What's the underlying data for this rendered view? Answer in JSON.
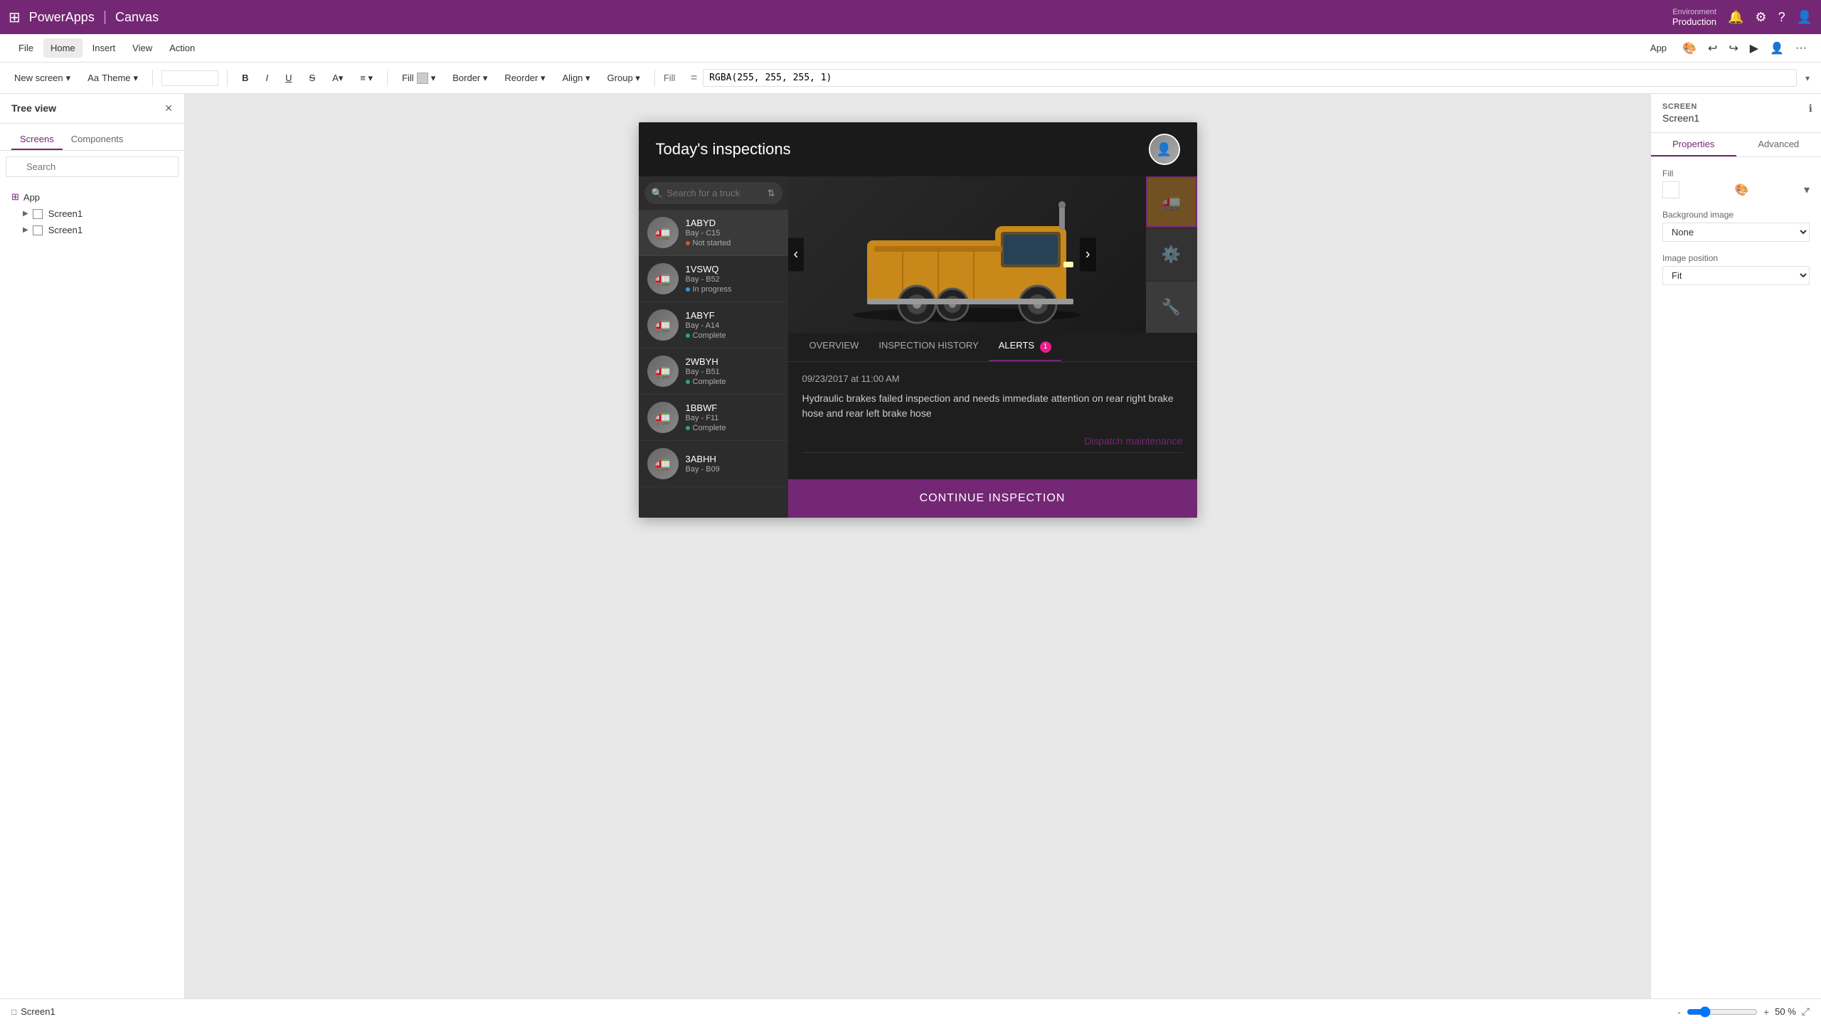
{
  "app": {
    "name": "PowerApps",
    "mode": "Canvas"
  },
  "topbar": {
    "brand": "PowerApps",
    "mode": "Canvas",
    "env_label": "Environment",
    "env_value": "Production"
  },
  "menubar": {
    "items": [
      "File",
      "Home",
      "Insert",
      "View",
      "Action"
    ],
    "active": "Home",
    "right_items": [
      "App"
    ],
    "toolbar_buttons": [
      "New screen",
      "Theme",
      "Fill",
      "Border",
      "Reorder",
      "Align",
      "Group"
    ]
  },
  "toolbar": {
    "fill_label": "Fill",
    "formula": "RGBA(255, 255, 255, 1)",
    "new_screen_label": "New screen",
    "theme_label": "Theme"
  },
  "sidebar": {
    "title": "Tree view",
    "tabs": [
      "Screens",
      "Components"
    ],
    "search_placeholder": "Search",
    "items": [
      {
        "id": "app",
        "label": "App",
        "type": "app"
      },
      {
        "id": "screen1a",
        "label": "Screen1",
        "type": "screen"
      },
      {
        "id": "screen1b",
        "label": "Screen1",
        "type": "screen"
      }
    ]
  },
  "canvas": {
    "title": "Today's inspections",
    "search_placeholder": "Search for a truck",
    "trucks": [
      {
        "id": "1ABYD",
        "name": "1ABYD",
        "bay": "Bay - C15",
        "status": "Not started",
        "status_type": "not-started"
      },
      {
        "id": "1VSWQ",
        "name": "1VSWQ",
        "bay": "Bay - B52",
        "status": "In progress",
        "status_type": "in-progress"
      },
      {
        "id": "1ABYF",
        "name": "1ABYF",
        "bay": "Bay - A14",
        "status": "Complete",
        "status_type": "complete"
      },
      {
        "id": "2WBYH",
        "name": "2WBYH",
        "bay": "Bay - B51",
        "status": "Complete",
        "status_type": "complete"
      },
      {
        "id": "1BBWF",
        "name": "1BBWF",
        "bay": "Bay - F11",
        "status": "Complete",
        "status_type": "complete"
      },
      {
        "id": "3ABHH",
        "name": "3ABHH",
        "bay": "Bay - B09",
        "status": "",
        "status_type": ""
      }
    ],
    "detail": {
      "tabs": [
        "OVERVIEW",
        "INSPECTION HISTORY",
        "ALERTS"
      ],
      "active_tab": "ALERTS",
      "alert_badge": "1",
      "alert_timestamp": "09/23/2017 at 11:00 AM",
      "alert_text": "Hydraulic brakes failed inspection and needs immediate attention on rear right brake hose and rear left brake hose",
      "dispatch_link": "Dispatch maintenance",
      "continue_btn": "CONTINUE INSPECTION"
    }
  },
  "properties": {
    "screen_label": "SCREEN",
    "screen_name": "Screen1",
    "tabs": [
      "Properties",
      "Advanced"
    ],
    "active_tab": "Properties",
    "fill_label": "Fill",
    "background_image_label": "Background image",
    "background_image_value": "None",
    "image_position_label": "Image position",
    "image_position_value": "Fit"
  },
  "statusbar": {
    "screen_name": "Screen1",
    "zoom_minus": "-",
    "zoom_plus": "+",
    "zoom_value": "50 %"
  }
}
